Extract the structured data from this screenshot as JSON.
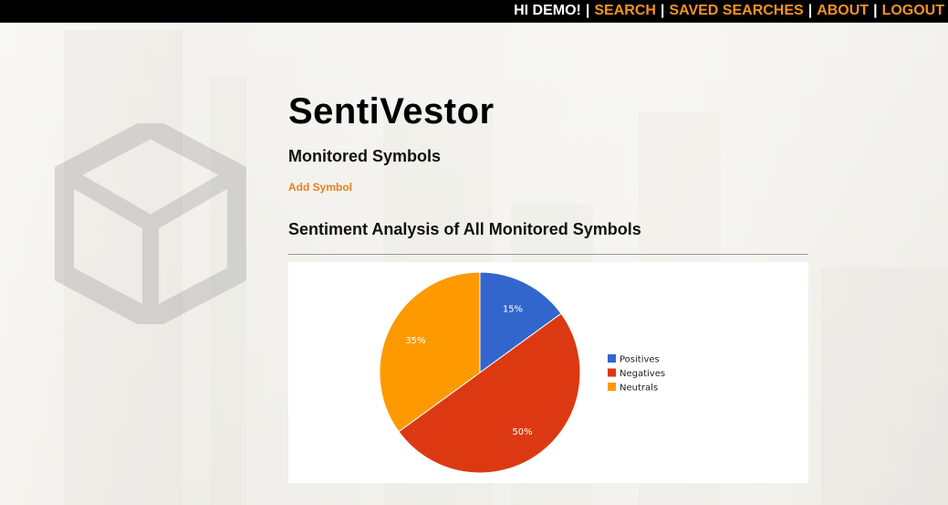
{
  "nav": {
    "greeting": "HI DEMO!",
    "separator": "|",
    "links": [
      "SEARCH",
      "SAVED SEARCHES",
      "ABOUT",
      "LOGOUT"
    ]
  },
  "main": {
    "app_title": "SentiVestor",
    "section_title": "Monitored Symbols",
    "add_symbol_label": "Add Symbol",
    "chart_heading": "Sentiment Analysis of All Monitored Symbols"
  },
  "colors": {
    "nav_link": "#f39322",
    "add_link": "#e8801e",
    "positives": "#3366cc",
    "negatives": "#dc3912",
    "neutrals": "#ff9900"
  },
  "chart_data": {
    "type": "pie",
    "title": "",
    "legend_position": "right",
    "slices": [
      {
        "name": "Positives",
        "value": 15,
        "label": "15%",
        "color": "#3366cc"
      },
      {
        "name": "Negatives",
        "value": 50,
        "label": "50%",
        "color": "#dc3912"
      },
      {
        "name": "Neutrals",
        "value": 35,
        "label": "35%",
        "color": "#ff9900"
      }
    ]
  }
}
